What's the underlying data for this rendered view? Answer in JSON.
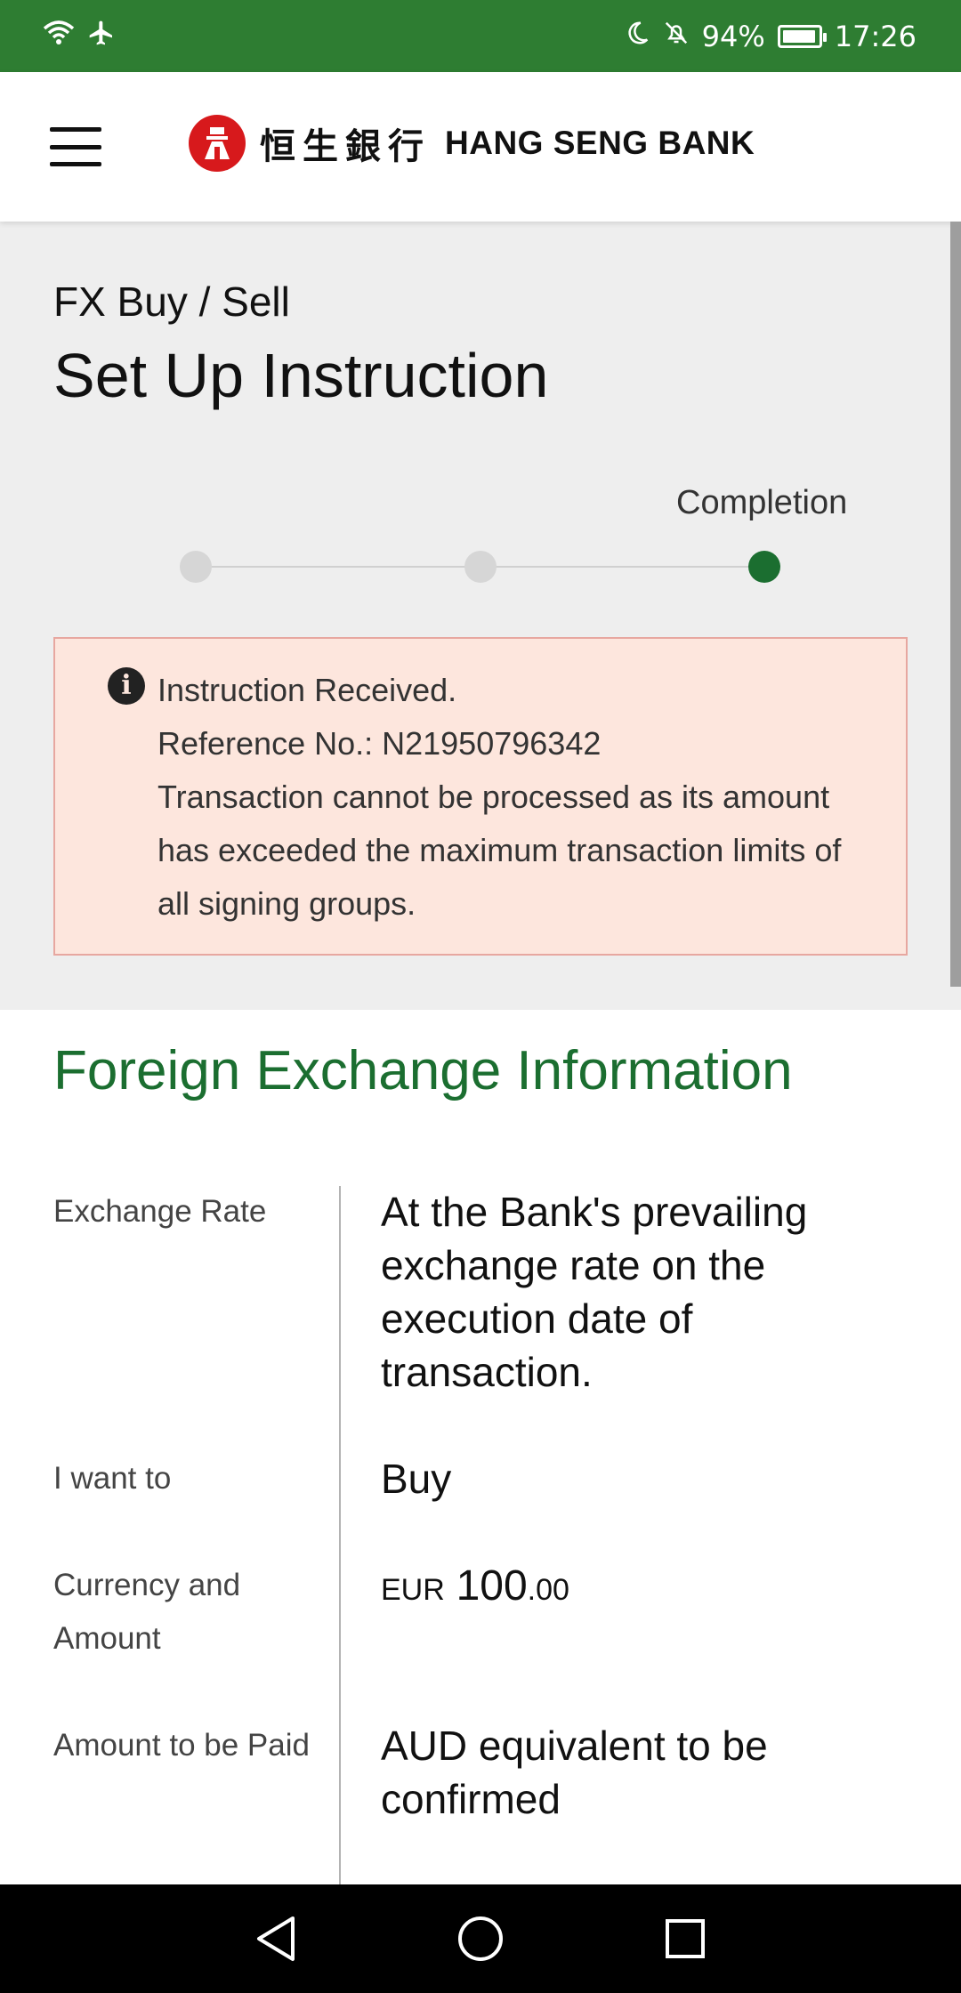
{
  "status_bar": {
    "battery": "94%",
    "time": "17:26"
  },
  "header": {
    "logo_cn": "恒生銀行",
    "logo_en": "HANG SENG BANK"
  },
  "page": {
    "breadcrumb": "FX Buy / Sell",
    "title": "Set Up Instruction"
  },
  "stepper": {
    "active_label": "Completion",
    "steps": 3,
    "active_step": 3
  },
  "alert": {
    "line1": "Instruction Received.",
    "line2": "Reference No.: N21950796342",
    "line3": "Transaction cannot be processed as its amount has exceeded the maximum transaction limits of all signing groups."
  },
  "info": {
    "section_title": "Foreign Exchange Information",
    "rows": [
      {
        "label": "Exchange Rate",
        "value": "At the Bank's prevailing exchange rate on the execution date of transaction."
      },
      {
        "label": "I want to",
        "value": "Buy"
      },
      {
        "label": "Currency and Amount",
        "currency": "EUR",
        "amount_int": "100",
        "amount_dec": ".00"
      },
      {
        "label": "Amount to be Paid",
        "value": "AUD equivalent to be confirmed"
      }
    ]
  },
  "colors": {
    "status_bar": "#2e7d32",
    "brand_green": "#1b6e30",
    "alert_bg": "#fde6dd",
    "logo_red": "#d7191c"
  }
}
